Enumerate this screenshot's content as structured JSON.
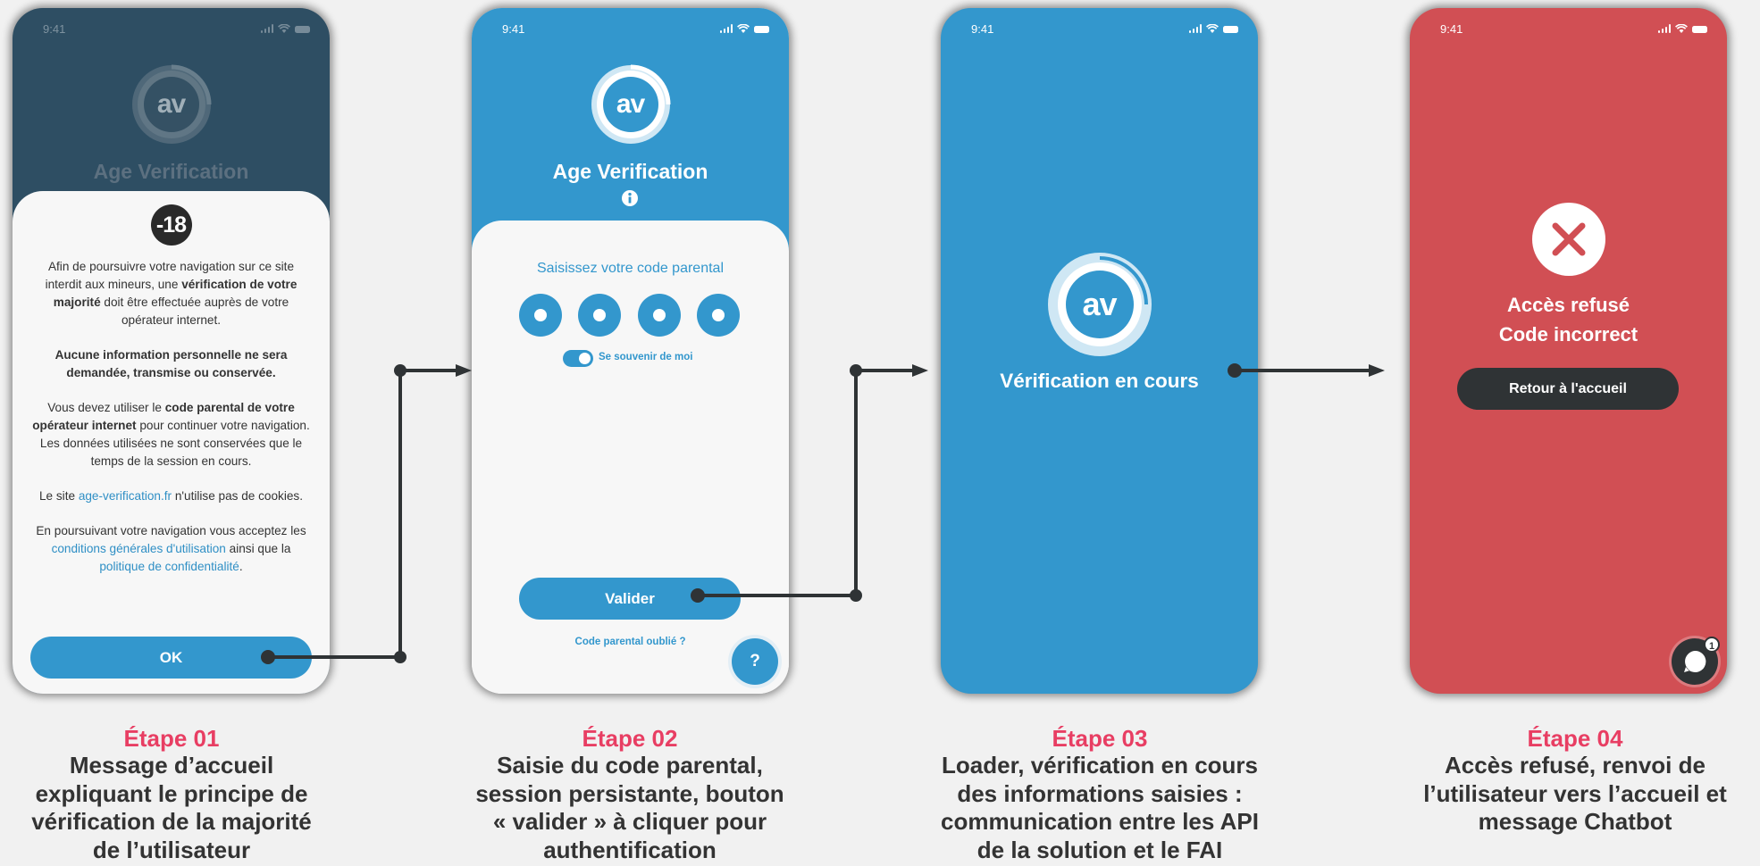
{
  "status_time": "9:41",
  "app_title": "Age Verification",
  "logo_text": "av",
  "colors": {
    "primary": "#3397cd",
    "danger": "#d14f54",
    "accent": "#e83e63",
    "dark": "#2f3335"
  },
  "screen1": {
    "badge": "-18",
    "para1_a": "Afin de poursuivre votre navigation sur ce site interdit aux mineurs, une ",
    "para1_b": "vérification de votre majorité",
    "para1_c": " doit être effectuée auprès de votre opérateur internet.",
    "para2": "Aucune information personnelle ne sera demandée, transmise ou conservée.",
    "para3_a": "Vous devez utiliser le ",
    "para3_b": "code parental de votre opérateur internet",
    "para3_c": " pour continuer votre navigation. Les données utilisées ne sont conservées que le temps de la session en cours.",
    "para4_a": "Le site ",
    "para4_link": "age-verification.fr",
    "para4_c": " n'utilise pas de cookies.",
    "para5_a": "En poursuivant votre navigation vous acceptez les ",
    "para5_link1": "conditions générales d'utilisation",
    "para5_b": " ainsi que la ",
    "para5_link2": "politique de confidentialité",
    "para5_c": ".",
    "ok_label": "OK"
  },
  "screen2": {
    "prompt": "Saisissez votre code parental",
    "remember_label": "Se souvenir de moi",
    "remember_on": true,
    "validate_label": "Valider",
    "forgot_label": "Code parental oublié ?",
    "help_label": "?"
  },
  "screen3": {
    "status": "Vérification en cours"
  },
  "screen4": {
    "line1": "Accès refusé",
    "line2": "Code incorrect",
    "back_label": "Retour à l'accueil",
    "chat_badge": "1"
  },
  "steps": [
    {
      "num": "Étape 01",
      "lines": [
        "Message d’accueil",
        "expliquant le principe de",
        "vérification de la majorité",
        "de l’utilisateur"
      ]
    },
    {
      "num": "Étape 02",
      "lines": [
        "Saisie du code parental,",
        "session persistante, bouton",
        "« valider » à cliquer pour",
        "authentification"
      ]
    },
    {
      "num": "Étape 03",
      "lines": [
        "Loader, vérification en cours",
        "des informations saisies :",
        "communication entre les API",
        "de la solution et le FAI"
      ]
    },
    {
      "num": "Étape 04",
      "lines": [
        "Accès refusé, renvoi de",
        "l’utilisateur vers l’accueil et",
        "message Chatbot"
      ]
    }
  ]
}
